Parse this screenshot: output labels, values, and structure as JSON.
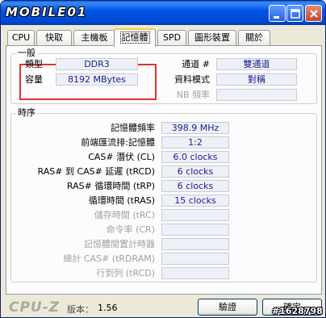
{
  "window": {
    "logo_text": "MOBILE01"
  },
  "tabs": [
    {
      "label": "CPU"
    },
    {
      "label": "快取"
    },
    {
      "label": "主機板"
    },
    {
      "label": "記憶體"
    },
    {
      "label": "SPD"
    },
    {
      "label": "圖形裝置"
    },
    {
      "label": "關於"
    }
  ],
  "active_tab": "記憶體",
  "general": {
    "title": "一般",
    "type_label": "類型",
    "type_value": "DDR3",
    "size_label": "容量",
    "size_value": "8192 MBytes",
    "channel_label": "通道 #",
    "channel_value": "雙通道",
    "dc_mode_label": "資料模式",
    "dc_mode_value": "對稱",
    "nb_freq_label": "NB 頻率",
    "nb_freq_value": ""
  },
  "timings": {
    "title": "時序",
    "rows": [
      {
        "label": "記憶體頻率",
        "value": "398.9 MHz",
        "enabled": true
      },
      {
        "label": "前端匯流排:記憶體",
        "value": "1:2",
        "enabled": true
      },
      {
        "label": "CAS# 潛伏 (CL)",
        "value": "6.0 clocks",
        "enabled": true
      },
      {
        "label": "RAS# 到 CAS# 延遲 (tRCD)",
        "value": "6 clocks",
        "enabled": true
      },
      {
        "label": "RAS# 循環時間 (tRP)",
        "value": "6 clocks",
        "enabled": true
      },
      {
        "label": "循環時間 (tRAS)",
        "value": "15 clocks",
        "enabled": true
      },
      {
        "label": "儲存時間 (tRC)",
        "value": "",
        "enabled": false
      },
      {
        "label": "命令率 (CR)",
        "value": "",
        "enabled": false
      },
      {
        "label": "記憶體閒置計時器",
        "value": "",
        "enabled": false
      },
      {
        "label": "總計 CAS# (tRDRAM)",
        "value": "",
        "enabled": false
      },
      {
        "label": "行到列 (tRCD)",
        "value": "",
        "enabled": false
      }
    ]
  },
  "footer": {
    "brand": "CPU-Z",
    "version_label": "版本：",
    "version_value": "1.56",
    "validate_label": "驗證",
    "ok_label": "確定",
    "watermark": "#1628798"
  },
  "colors": {
    "titlebar": "#0055e5",
    "value_text": "#19218e",
    "highlight_box": "#e03030"
  }
}
